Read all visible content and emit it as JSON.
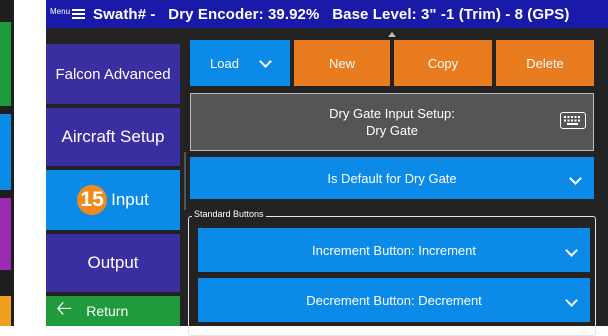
{
  "title_bar": {
    "menu_label": "Menu",
    "title": "Swath# -   Dry Encoder: 39.92%   Base Level: 3\" -1 (Trim) - 8 (GPS)"
  },
  "left_strip_colors": [
    "#1c9c3c",
    "#0c8ae8",
    "#9b2bb0",
    "#f0a020"
  ],
  "nav": {
    "items": [
      {
        "label": "Falcon Advanced",
        "color": "#3a2fa0"
      },
      {
        "label": "Aircraft Setup",
        "color": "#3a2fa0"
      },
      {
        "label": "Input",
        "badge": "15",
        "color": "#0c8ae8"
      },
      {
        "label": "Output",
        "color": "#3a2fa0"
      }
    ],
    "return_label": "Return"
  },
  "actions": {
    "load_label": "Load",
    "new_label": "New",
    "copy_label": "Copy",
    "delete_label": "Delete"
  },
  "setup_panel": {
    "line1": "Dry Gate Input Setup:",
    "line2": "Dry Gate",
    "icon": "keyboard-icon"
  },
  "default_dropdown": "Is Default for Dry Gate",
  "standard_buttons": {
    "label": "Standard Buttons",
    "items": [
      "Increment Button: Increment",
      "Decrement Button: Decrement"
    ]
  },
  "colors": {
    "title_bar": "#1a1aa8",
    "accent_blue": "#0c8ae8",
    "accent_orange": "#e87c1e",
    "nav_purple": "#3a2fa0",
    "return_green": "#1f9b3d",
    "badge_orange": "#f08a1c"
  }
}
